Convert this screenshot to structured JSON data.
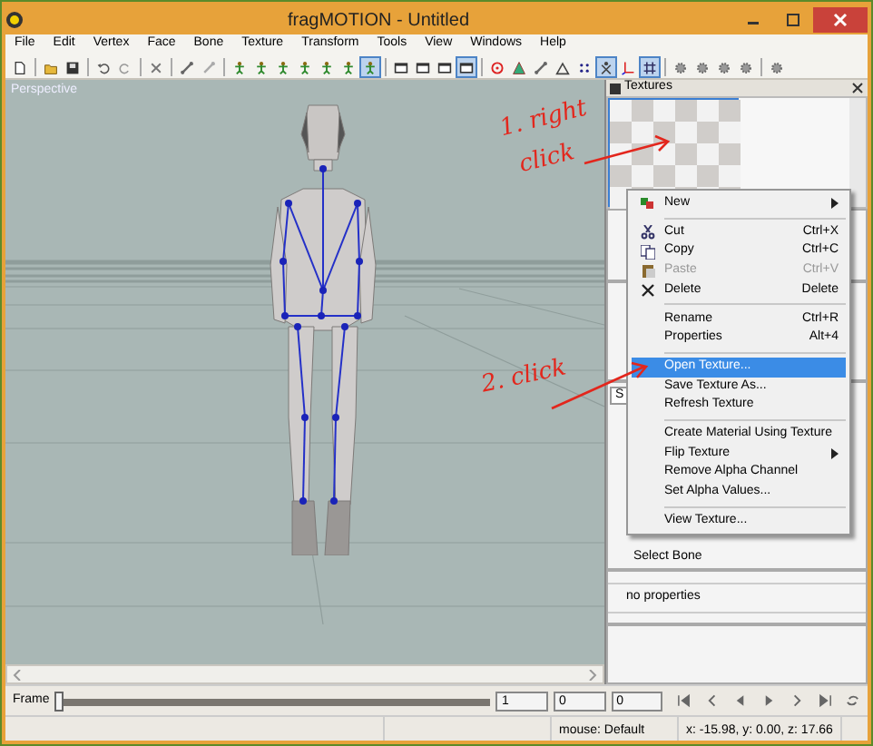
{
  "window": {
    "title": "fragMOTION - Untitled"
  },
  "menu": [
    "File",
    "Edit",
    "Vertex",
    "Face",
    "Bone",
    "Texture",
    "Transform",
    "Tools",
    "View",
    "Windows",
    "Help"
  ],
  "toolbar": [
    {
      "kind": "button",
      "pressed": false
    },
    {
      "kind": "separator"
    },
    {
      "kind": "button",
      "pressed": false
    },
    {
      "kind": "button",
      "pressed": false
    },
    {
      "kind": "separator"
    },
    {
      "kind": "button",
      "pressed": false
    },
    {
      "kind": "button",
      "pressed": false
    },
    {
      "kind": "separator"
    },
    {
      "kind": "button",
      "pressed": false
    },
    {
      "kind": "separator"
    },
    {
      "kind": "button",
      "pressed": false
    },
    {
      "kind": "button",
      "pressed": false
    },
    {
      "kind": "separator"
    },
    {
      "kind": "button",
      "pressed": false
    },
    {
      "kind": "button",
      "pressed": false
    },
    {
      "kind": "button",
      "pressed": false
    },
    {
      "kind": "button",
      "pressed": false
    },
    {
      "kind": "button",
      "pressed": false
    },
    {
      "kind": "button",
      "pressed": false
    },
    {
      "kind": "button",
      "pressed": true
    },
    {
      "kind": "separator"
    },
    {
      "kind": "button",
      "pressed": false
    },
    {
      "kind": "button",
      "pressed": false
    },
    {
      "kind": "button",
      "pressed": false
    },
    {
      "kind": "button",
      "pressed": true
    },
    {
      "kind": "separator"
    },
    {
      "kind": "button",
      "pressed": false
    },
    {
      "kind": "button",
      "pressed": false
    },
    {
      "kind": "button",
      "pressed": false
    },
    {
      "kind": "button",
      "pressed": false
    },
    {
      "kind": "button",
      "pressed": false
    },
    {
      "kind": "button",
      "pressed": true
    },
    {
      "kind": "button",
      "pressed": false
    },
    {
      "kind": "button",
      "pressed": true
    },
    {
      "kind": "separator"
    },
    {
      "kind": "button",
      "pressed": false
    },
    {
      "kind": "button",
      "pressed": false
    },
    {
      "kind": "button",
      "pressed": false
    },
    {
      "kind": "button",
      "pressed": false
    },
    {
      "kind": "separator"
    },
    {
      "kind": "button",
      "pressed": false
    }
  ],
  "viewport": {
    "label": "Perspective"
  },
  "textures_panel": {
    "title": "Textures"
  },
  "dock": {
    "dropdown_value": "S",
    "tool_item": "Select Bone",
    "properties_text": "no properties"
  },
  "context_menu": [
    {
      "kind": "submenu",
      "label": "New",
      "disabled": false,
      "selected": false
    },
    {
      "kind": "separator"
    },
    {
      "kind": "item",
      "label": "Cut",
      "shortcut": "Ctrl+X",
      "disabled": false,
      "selected": false
    },
    {
      "kind": "item",
      "label": "Copy",
      "shortcut": "Ctrl+C",
      "disabled": false,
      "selected": false
    },
    {
      "kind": "item",
      "label": "Paste",
      "shortcut": "Ctrl+V",
      "disabled": true,
      "selected": false
    },
    {
      "kind": "item",
      "label": "Delete",
      "shortcut": "Delete",
      "disabled": false,
      "selected": false
    },
    {
      "kind": "separator"
    },
    {
      "kind": "item",
      "label": "Rename",
      "shortcut": "Ctrl+R",
      "disabled": false,
      "selected": false
    },
    {
      "kind": "item",
      "label": "Properties",
      "shortcut": "Alt+4",
      "disabled": false,
      "selected": false
    },
    {
      "kind": "separator"
    },
    {
      "kind": "item",
      "label": "Open Texture...",
      "disabled": false,
      "selected": true
    },
    {
      "kind": "item",
      "label": "Save Texture As...",
      "disabled": false,
      "selected": false
    },
    {
      "kind": "item",
      "label": "Refresh Texture",
      "disabled": false,
      "selected": false
    },
    {
      "kind": "separator"
    },
    {
      "kind": "item",
      "label": "Create Material Using Texture",
      "disabled": false,
      "selected": false
    },
    {
      "kind": "submenu",
      "label": "Flip Texture",
      "disabled": false,
      "selected": false
    },
    {
      "kind": "item",
      "label": "Remove Alpha Channel",
      "disabled": false,
      "selected": false
    },
    {
      "kind": "item",
      "label": "Set Alpha Values...",
      "disabled": false,
      "selected": false
    },
    {
      "kind": "separator"
    },
    {
      "kind": "item",
      "label": "View Texture...",
      "disabled": false,
      "selected": false
    }
  ],
  "annotations": [
    {
      "text": "1. right"
    },
    {
      "text": "click"
    },
    {
      "text": "2. click"
    }
  ],
  "frame_bar": {
    "label": "Frame",
    "level": 0,
    "fields": [
      "1",
      "0",
      "0"
    ]
  },
  "status_bar": [
    "mouse: Default",
    "x: -15.98, y: 0.00, z: 17.66"
  ]
}
